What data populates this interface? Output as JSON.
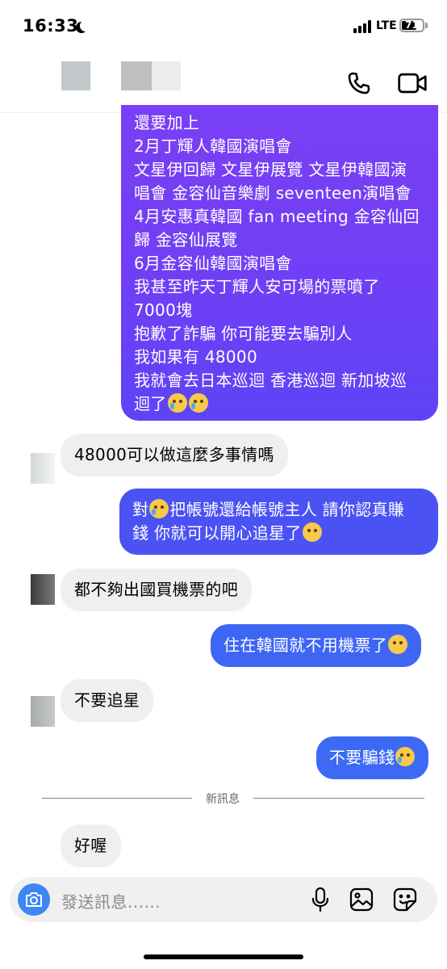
{
  "status": {
    "time": "16:33",
    "network": "LTE",
    "battery": "71",
    "battery_level": 0.71
  },
  "header": {
    "call_icon": "phone-icon",
    "video_icon": "video-camera-icon"
  },
  "colors": {
    "outgoing": "#3f67f5",
    "outgoing_gradient_top": "#7a3ff4",
    "incoming": "#efefef",
    "accent": "#3d86f5"
  },
  "messages": {
    "m1_lines": [
      "還要加上",
      "2月丁輝人韓國演唱會",
      "文星伊回歸 文星伊展覽 文星伊韓國演",
      "唱會 金容仙音樂劇 seventeen演唱會",
      "4月安惠真韓國 fan meeting 金容仙回",
      "歸 金容仙展覽",
      "6月金容仙韓國演唱會",
      "我甚至昨天丁輝人安可場的票噴了",
      "7000塊",
      "抱歉了詐騙 你可能要去騙別人",
      "我如果有 48000",
      "我就會去日本巡迴 香港巡迴 新加坡巡",
      "迴了"
    ],
    "m2": "48000可以做這麼多事情嗎",
    "m3_part1": "對",
    "m3_part2": "把帳號還給帳號主人 請你認真賺",
    "m3_part3": "錢 你就可以開心追星了",
    "m4": "都不夠出國買機票的吧",
    "m5": "住在韓國就不用機票了",
    "m6": "不要追星",
    "m7": "不要騙錢",
    "m8": "好喔"
  },
  "divider": {
    "label": "新訊息"
  },
  "composer": {
    "placeholder": "發送訊息......"
  }
}
